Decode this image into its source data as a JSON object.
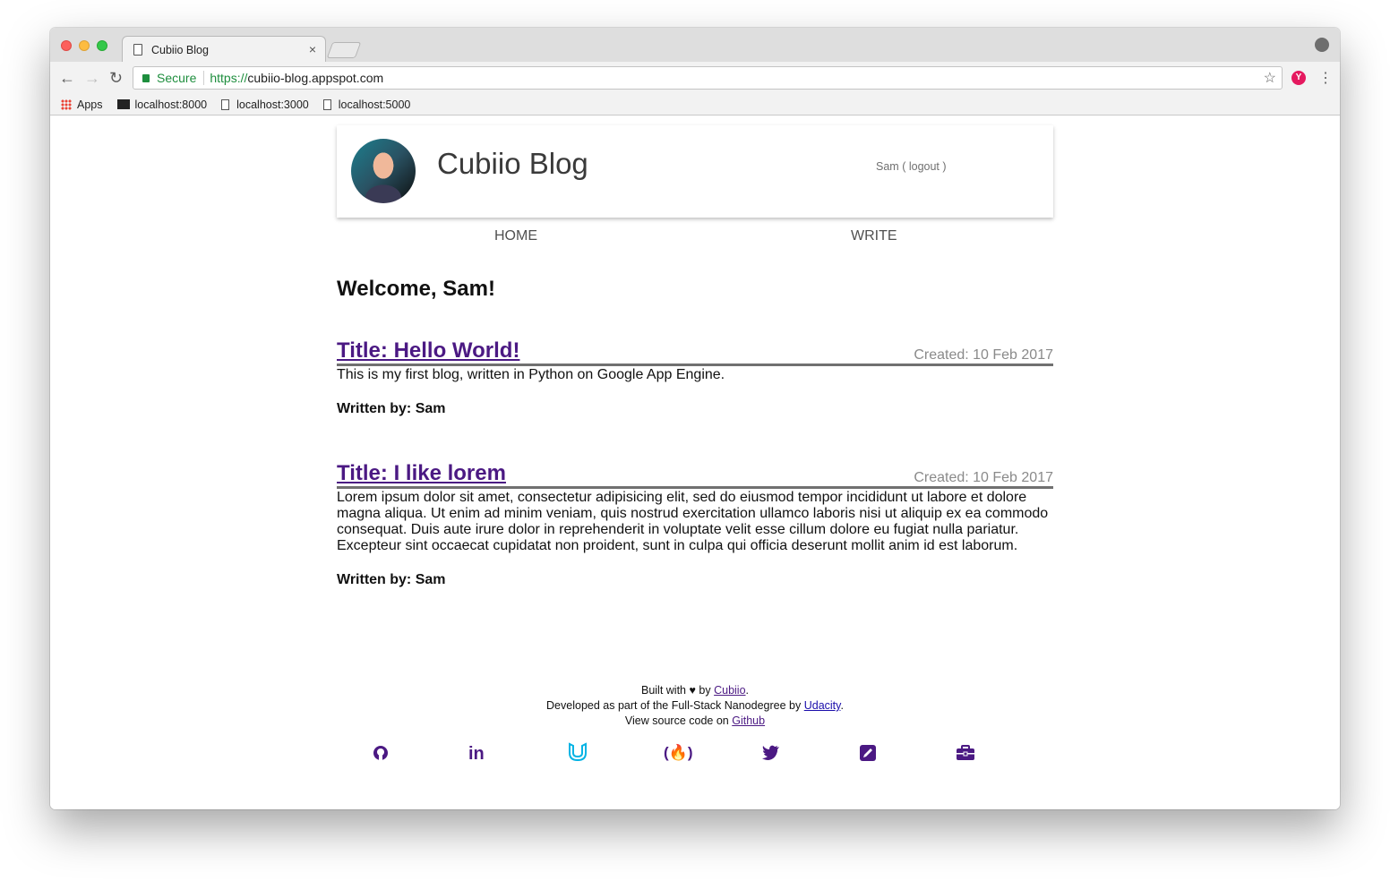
{
  "browser": {
    "tab_title": "Cubiio Blog",
    "tab_close": "×",
    "secure_label": "Secure",
    "url_scheme": "https://",
    "url_host": "cubiio-blog.appspot.com",
    "bookmarks": [
      "Apps",
      "localhost:8000",
      "localhost:3000",
      "localhost:5000"
    ]
  },
  "header": {
    "blog_title": "Cubiio Blog",
    "user_name": "Sam",
    "logout_label": "logout"
  },
  "nav": {
    "home": "HOME",
    "write": "WRITE"
  },
  "welcome": "Welcome, Sam!",
  "posts": [
    {
      "title": "Title: Hello World!",
      "created": "Created: 10 Feb 2017",
      "body": "This is my first blog, written in Python on Google App Engine.",
      "author": "Written by: Sam"
    },
    {
      "title": "Title: I like lorem",
      "created": "Created: 10 Feb 2017",
      "body": "Lorem ipsum dolor sit amet, consectetur adipisicing elit, sed do eiusmod tempor incididunt ut labore et dolore magna aliqua. Ut enim ad minim veniam, quis nostrud exercitation ullamco laboris nisi ut aliquip ex ea commodo consequat. Duis aute irure dolor in reprehenderit in voluptate velit esse cillum dolore eu fugiat nulla pariatur. Excepteur sint occaecat cupidatat non proident, sunt in culpa qui officia deserunt mollit anim id est laborum.",
      "author": "Written by: Sam"
    }
  ],
  "footer": {
    "built_prefix": "Built with",
    "built_by": "by",
    "built_link": "Cubiio",
    "dev_prefix": "Developed as part of the Full-Stack Nanodegree by",
    "dev_link": "Udacity",
    "source_prefix": "View source code on",
    "source_link": "Github"
  },
  "social_icons": [
    "github-icon",
    "linkedin-icon",
    "udacity-icon",
    "freecodecamp-icon",
    "twitter-icon",
    "blog-edit-icon",
    "briefcase-icon"
  ],
  "colors": {
    "accent": "#4b1983",
    "udacity": "#02b3e4"
  }
}
